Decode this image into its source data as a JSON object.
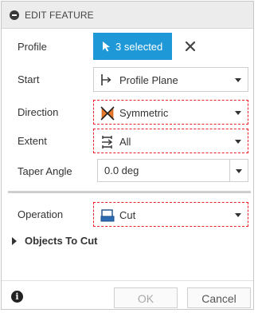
{
  "header": {
    "title": "EDIT FEATURE"
  },
  "rows": {
    "profile": {
      "label": "Profile",
      "selection": "3 selected"
    },
    "start": {
      "label": "Start",
      "value": "Profile Plane"
    },
    "direction": {
      "label": "Direction",
      "value": "Symmetric"
    },
    "extent": {
      "label": "Extent",
      "value": "All"
    },
    "taper": {
      "label": "Taper Angle",
      "value": "0.0 deg"
    },
    "operation": {
      "label": "Operation",
      "value": "Cut"
    }
  },
  "objects_to_cut": {
    "label": "Objects To Cut"
  },
  "footer": {
    "info": "i",
    "ok_label": "OK",
    "cancel_label": "Cancel"
  },
  "colors": {
    "accent": "#1e98d7",
    "highlight": "#e8202a",
    "direction_icon": "#e8782a"
  },
  "icons": [
    "collapse-icon",
    "cursor-arrow-icon",
    "close-icon",
    "profile-plane-icon",
    "symmetric-icon",
    "extent-all-icon",
    "cut-icon",
    "expand-triangle-icon",
    "info-icon"
  ]
}
